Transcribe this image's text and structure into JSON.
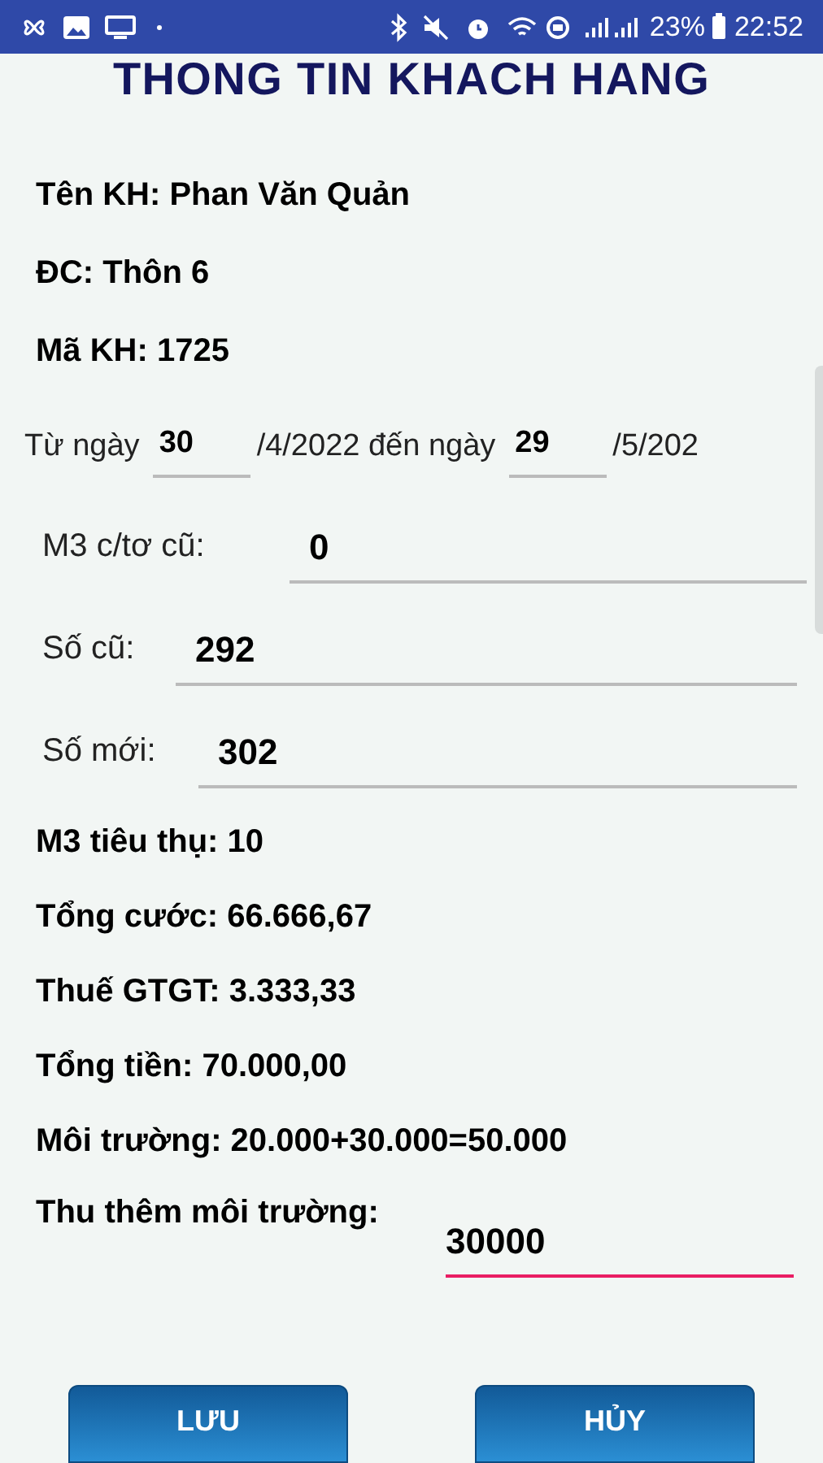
{
  "status_bar": {
    "battery": "23%",
    "time": "22:52"
  },
  "title": "THONG TIN KHACH HANG",
  "info": [
    "Tên KH: Phan Văn Quản",
    "ĐC: Thôn 6",
    "Mã KH: 1725"
  ],
  "date_row": {
    "from_label": "Từ ngày",
    "from_day": "30",
    "middle": "/4/2022 đến ngày",
    "to_day": "29",
    "end": "/5/202"
  },
  "fields": [
    {
      "label": "M3 c/tơ cũ:",
      "value": "0",
      "focused": false
    },
    {
      "label": "Số cũ:",
      "value": "292",
      "focused": false
    },
    {
      "label": "Số mới:",
      "value": "302",
      "focused": false
    }
  ],
  "totals": [
    "M3 tiêu thụ: 10",
    "Tổng cước: 66.666,67",
    "Thuế GTGT: 3.333,33",
    "Tổng tiền: 70.000,00",
    "Môi trường: 20.000+30.000=50.000"
  ],
  "extra": {
    "label": "Thu thêm môi trường:",
    "value": "30000",
    "focused": true
  },
  "buttons": [
    "LƯU",
    "HỦY"
  ]
}
